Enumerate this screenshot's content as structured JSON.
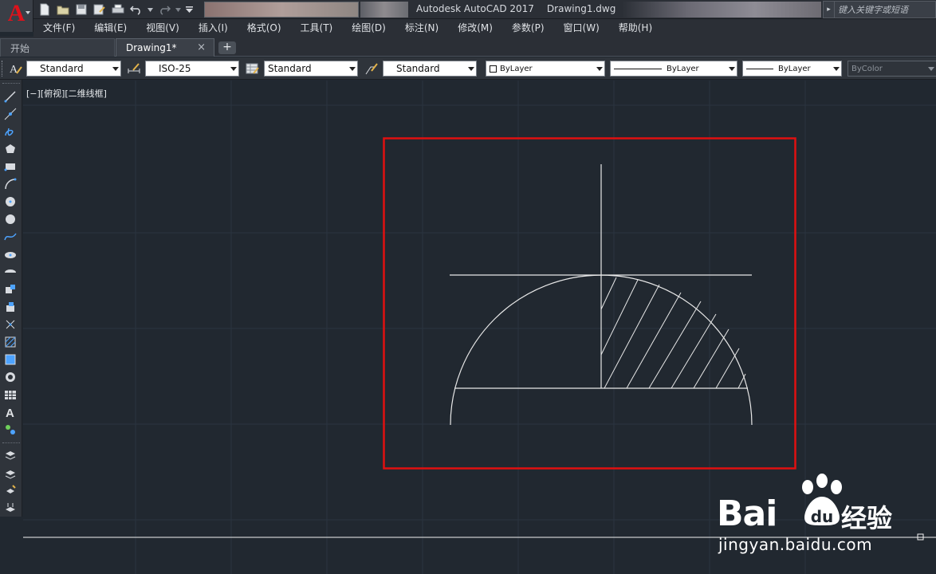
{
  "app": {
    "logo_letter": "A",
    "title": "Autodesk AutoCAD 2017",
    "document": "Drawing1.dwg",
    "search_placeholder": "键入关键字或短语"
  },
  "menu": [
    {
      "label": "文件(F)"
    },
    {
      "label": "编辑(E)"
    },
    {
      "label": "视图(V)"
    },
    {
      "label": "插入(I)"
    },
    {
      "label": "格式(O)"
    },
    {
      "label": "工具(T)"
    },
    {
      "label": "绘图(D)"
    },
    {
      "label": "标注(N)"
    },
    {
      "label": "修改(M)"
    },
    {
      "label": "参数(P)"
    },
    {
      "label": "窗口(W)"
    },
    {
      "label": "帮助(H)"
    }
  ],
  "tabs": {
    "start": "开始",
    "active": "Drawing1*",
    "close_glyph": "×",
    "add_glyph": "+"
  },
  "properties": {
    "text_style": "Standard",
    "dim_style": "ISO-25",
    "table_style": "Standard",
    "multileader_style": "Standard",
    "layer_color": "ByLayer",
    "linetype": "ByLayer",
    "lineweight": "ByLayer",
    "plot_style": "ByColor"
  },
  "canvas": {
    "view_label": "[−][俯视][二维线框]"
  },
  "watermark": {
    "brand": "Bai",
    "brand_cn": "经验",
    "url": "jingyan.baidu.com"
  },
  "colors": {
    "canvas_bg": "#212830",
    "highlight_frame": "#e01010",
    "drawing_lines": "#e8e8e8",
    "logo_red": "#e0121b"
  }
}
